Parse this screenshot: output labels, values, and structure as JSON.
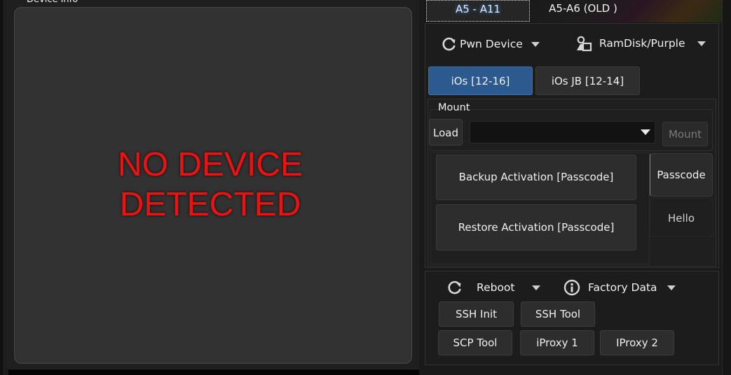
{
  "device_info": {
    "group_title": "Device Info",
    "status_line1": "NO DEVICE",
    "status_line2": "DETECTED",
    "status_color": "#ee1111"
  },
  "top_tabs": [
    {
      "label": "A5 - A11",
      "selected": true
    },
    {
      "label": "A5-A6 (OLD )",
      "selected": false
    }
  ],
  "main_menu": {
    "pwn_device": {
      "label": "Pwn Device",
      "icon": "refresh-icon"
    },
    "ramdisk": {
      "label": "RamDisk/Purple",
      "icon": "user-box-icon"
    }
  },
  "ios_tabs": [
    {
      "label": "iOs [12-16]",
      "selected": true
    },
    {
      "label": "iOs JB [12-14]",
      "selected": false
    }
  ],
  "mount": {
    "group_title": "Mount",
    "load_label": "Load",
    "combo_value": "",
    "mount_label": "Mount",
    "mount_enabled": false
  },
  "activation": {
    "backup_label": "Backup Activation [Passcode]",
    "restore_label": "Restore Activation [Passcode]",
    "side_tabs": [
      {
        "label": "Passcode",
        "selected": true
      },
      {
        "label": "Hello",
        "selected": false
      }
    ]
  },
  "tools": {
    "reboot": {
      "label": "Reboot",
      "icon": "refresh-icon"
    },
    "factory_data": {
      "label": "Factory Data",
      "icon": "info-circle-icon"
    },
    "buttons": [
      {
        "label": "SSH Init"
      },
      {
        "label": "SSH Tool"
      },
      {
        "label": "SCP Tool"
      },
      {
        "label": "iProxy 1"
      },
      {
        "label": "IProxy 2"
      }
    ]
  },
  "colors": {
    "accent": "#2d5a8e",
    "background": "#1c1c1c"
  }
}
